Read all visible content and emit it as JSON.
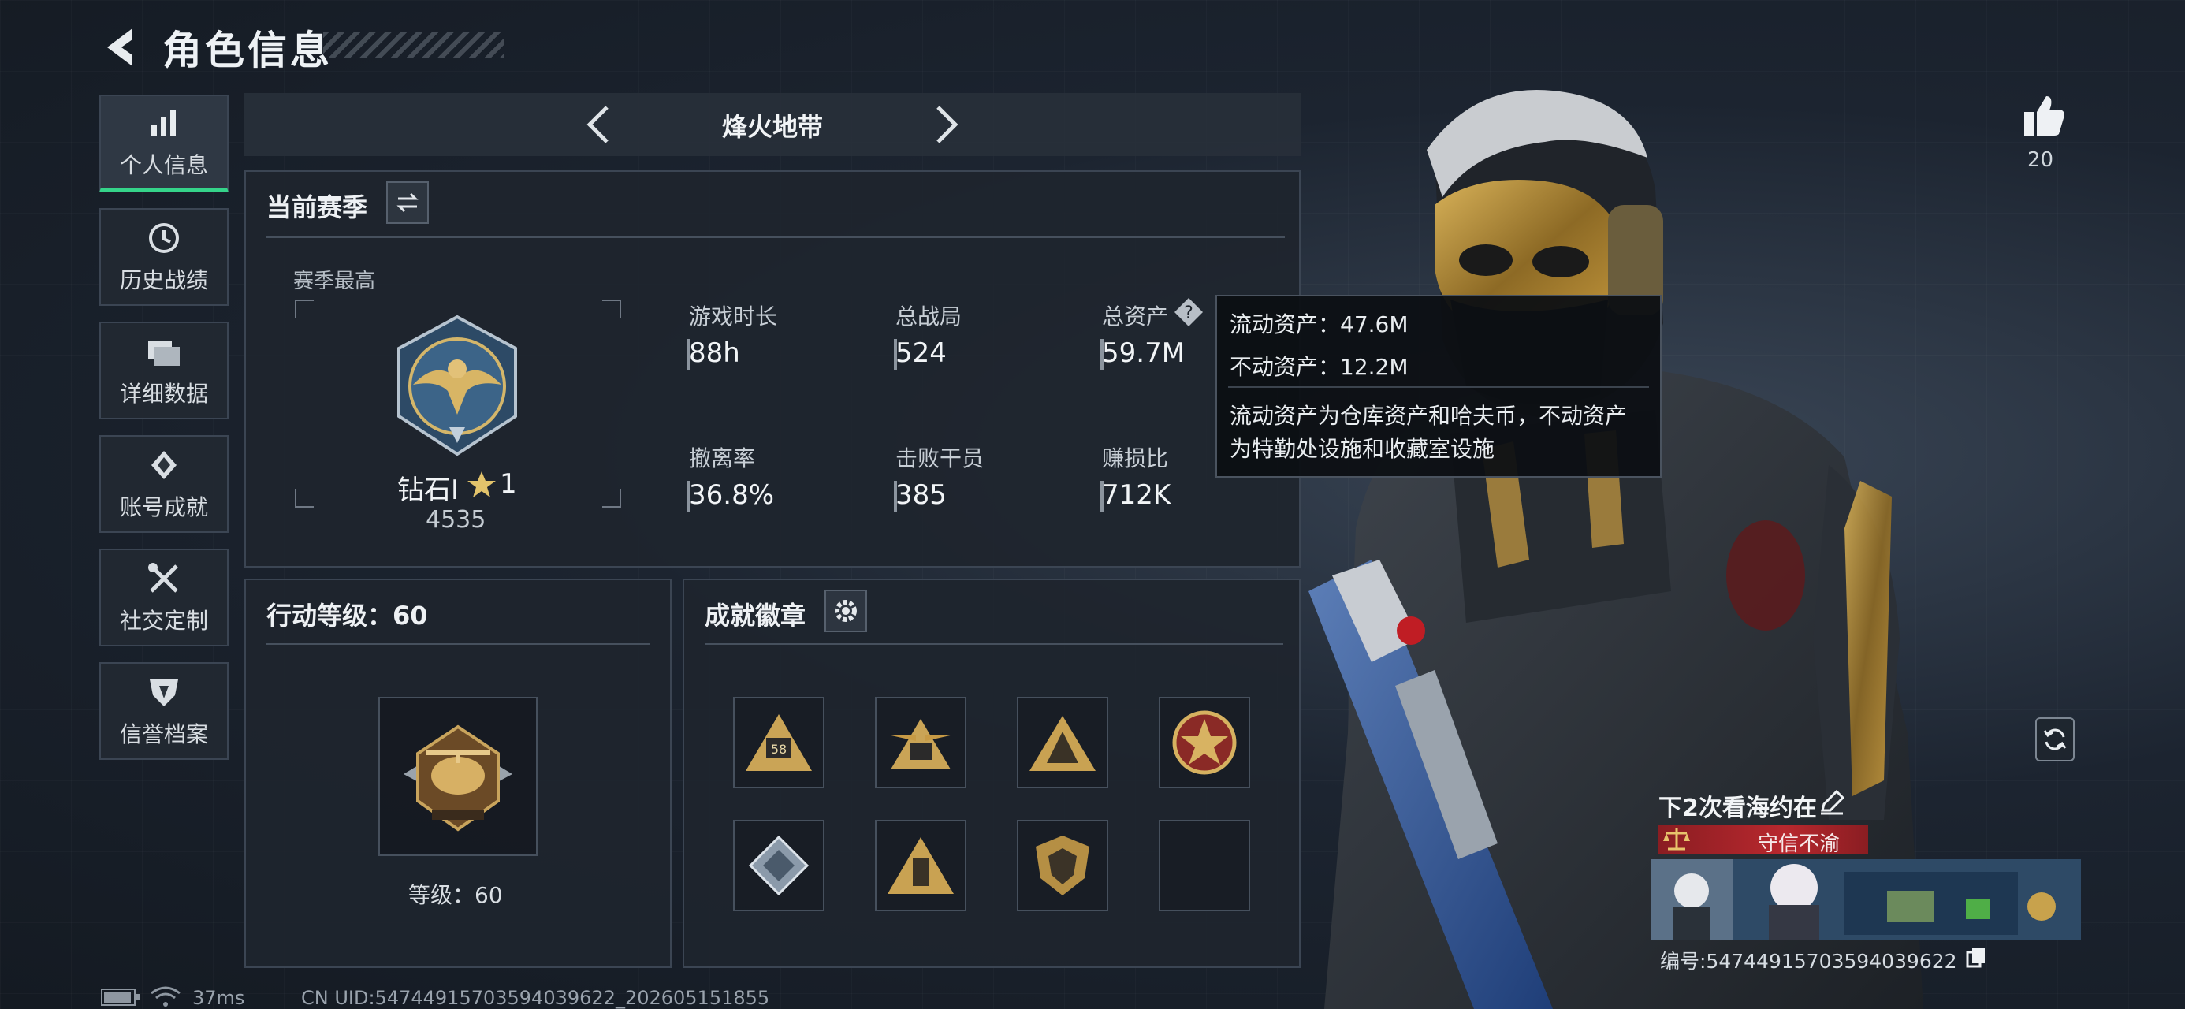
{
  "header": {
    "title": "角色信息"
  },
  "nav": [
    {
      "label": "个人信息",
      "icon": "bar-chart-icon",
      "active": true
    },
    {
      "label": "历史战绩",
      "icon": "history-icon"
    },
    {
      "label": "详细数据",
      "icon": "folder-icon"
    },
    {
      "label": "账号成就",
      "icon": "achievement-icon"
    },
    {
      "label": "社交定制",
      "icon": "tools-icon"
    },
    {
      "label": "信誉档案",
      "icon": "shield-icon"
    }
  ],
  "mode": {
    "label": "烽火地带"
  },
  "season": {
    "title": "当前赛季",
    "best_label": "赛季最高",
    "rank_name": "钻石I",
    "stars": "1",
    "rank_score": "4535",
    "stats": [
      {
        "label": "游戏时长",
        "value": "88h"
      },
      {
        "label": "总战局",
        "value": "524"
      },
      {
        "label": "总资产",
        "value": "59.7M"
      },
      {
        "label": "撤离率",
        "value": "36.8%"
      },
      {
        "label": "击败干员",
        "value": "385"
      },
      {
        "label": "赚损比",
        "value": "712K"
      }
    ]
  },
  "tooltip": {
    "liquid": "流动资产：47.6M",
    "fixed": "不动资产：12.2M",
    "desc_line1": "流动资产为仓库资产和哈夫币，不动资产",
    "desc_line2": "为特勤处设施和收藏室设施"
  },
  "action_level": {
    "title": "行动等级：60",
    "level_label": "等级：60"
  },
  "badges": {
    "title": "成就徽章",
    "items": [
      "badge-58-icon",
      "badge-58-winged-icon",
      "badge-triangle-icon",
      "badge-star-icon",
      "badge-gem-icon",
      "badge-pillar-icon",
      "badge-shield-icon",
      "empty-slot"
    ]
  },
  "profile": {
    "likes": "20",
    "name": "下2次看海约在",
    "reputation": "守信不渝",
    "uid_label": "编号:5474491570359403962​2"
  },
  "status_bar": {
    "ping": "37ms",
    "uid": "CN UID:54744915703594039622_202605151855"
  }
}
